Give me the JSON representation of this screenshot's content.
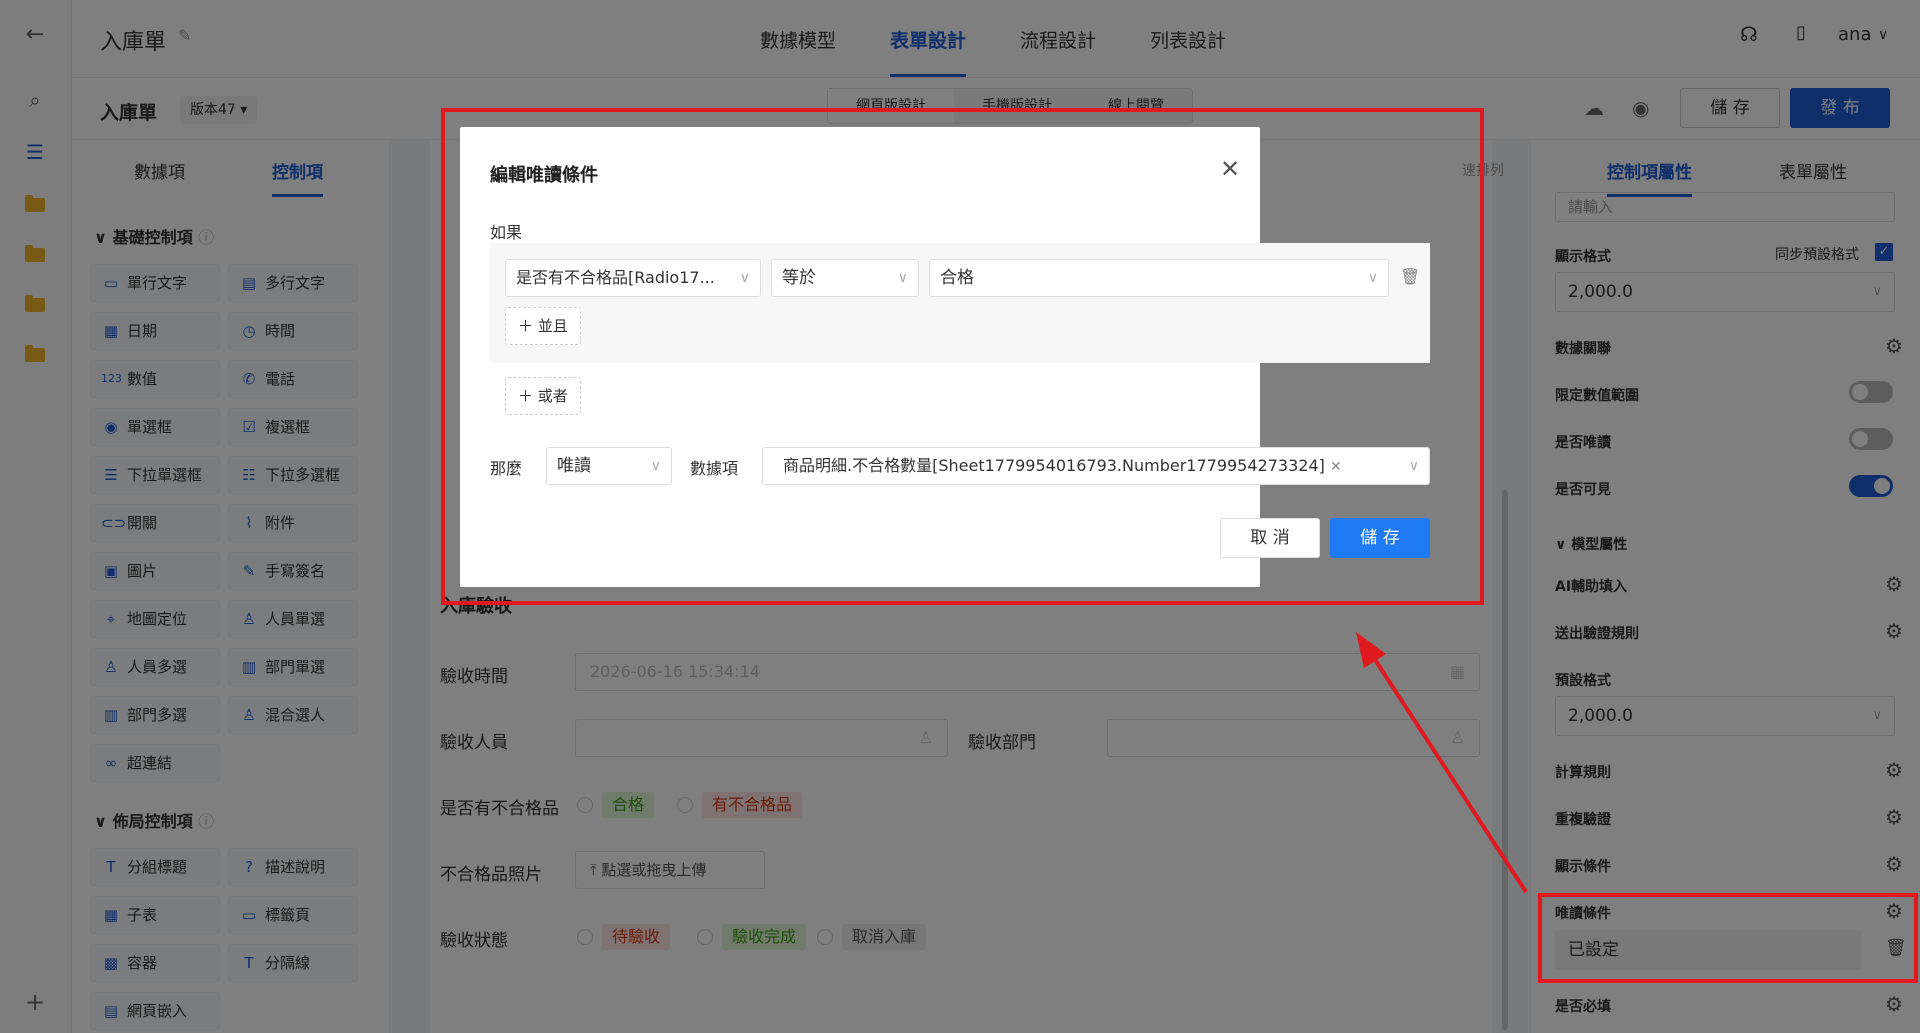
{
  "header": {
    "title": "入庫單",
    "tabs": [
      "數據模型",
      "表單設計",
      "流程設計",
      "列表設計"
    ],
    "active_tab": "表單設計",
    "user": "ana"
  },
  "subheader": {
    "form_name": "入庫單",
    "version": "版本47",
    "view_tabs": [
      "網頁版設計",
      "手機版設計",
      "線上閱覽"
    ],
    "save_label": "儲 存",
    "publish_label": "發 布"
  },
  "left_panel": {
    "tabs": [
      "數據項",
      "控制項"
    ],
    "active_tab": "控制項",
    "section_basic": "基礎控制項",
    "basic_controls": [
      "單行文字",
      "多行文字",
      "日期",
      "時間",
      "數值",
      "電話",
      "單選框",
      "複選框",
      "下拉單選框",
      "下拉多選框",
      "開關",
      "附件",
      "圖片",
      "手寫簽名",
      "地圖定位",
      "人員單選",
      "人員多選",
      "部門單選",
      "部門多選",
      "混合選人",
      "超連結"
    ],
    "section_layout": "佈局控制項",
    "layout_controls": [
      "分組標題",
      "描述說明",
      "子表",
      "標籤頁",
      "容器",
      "分隔線",
      "網頁嵌入"
    ]
  },
  "canvas": {
    "group_title": "入庫驗收",
    "fields": {
      "inspect_time_label": "驗收時間",
      "inspect_time_value": "2026-06-16 15:34:14",
      "inspector_label": "驗收人員",
      "inspect_dept_label": "驗收部門",
      "has_defect_label": "是否有不合格品",
      "pass_tag": "合格",
      "fail_tag": "有不合格品",
      "defect_photo_label": "不合格品照片",
      "upload_label": "點選或拖曳上傳",
      "status_label": "驗收狀態",
      "status_tags": [
        "待驗收",
        "驗收完成",
        "取消入庫"
      ]
    },
    "side_marker": "速排列"
  },
  "right_panel": {
    "tabs": [
      "控制項屬性",
      "表單屬性"
    ],
    "active_tab": "控制項屬性",
    "placeholder_value": "請輸入",
    "display_format_label": "顯示格式",
    "sync_default_label": "同步預設格式",
    "display_format_value": "2,000.0",
    "data_link_label": "數據關聯",
    "limit_range_label": "限定數值範圍",
    "readonly_label": "是否唯讀",
    "visible_label": "是否可見",
    "model_attr_label": "模型屬性",
    "ai_fill_label": "AI輔助填入",
    "submit_rule_label": "送出驗證規則",
    "default_format_label": "預設格式",
    "default_format_value": "2,000.0",
    "calc_rule_label": "計算規則",
    "dup_check_label": "重複驗證",
    "show_cond_label": "顯示條件",
    "readonly_cond_label": "唯讀條件",
    "readonly_cond_value": "已設定",
    "required_label": "是否必填",
    "toggles": {
      "limit_range": false,
      "readonly": false,
      "visible": true
    }
  },
  "modal": {
    "title": "編輯唯讀條件",
    "if_label": "如果",
    "condition_field": "是否有不合格品[Radio17...",
    "condition_operator": "等於",
    "condition_value": "合格",
    "and_button": "並且",
    "or_button": "或者",
    "then_label": "那麼",
    "action_value": "唯讀",
    "data_item_label": "數據項",
    "data_item_tag": "商品明細.不合格數量[Sheet1779954016793.Number1779954273324]",
    "cancel_label": "取 消",
    "save_label": "儲 存"
  },
  "colors": {
    "accent": "#1f5fd6",
    "annotation_red": "#e0191f",
    "pass_green": "#52c41a",
    "fail_red": "#ff4d4f"
  }
}
